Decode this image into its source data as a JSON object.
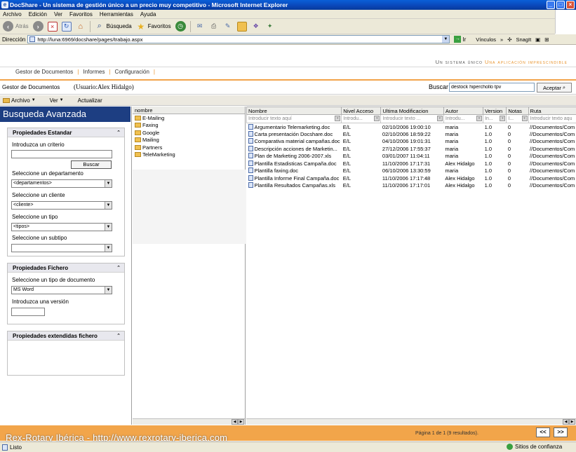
{
  "window": {
    "title": "DocShare - Un sistema de gestión único a un precio muy competitivo - Microsoft Internet Explorer"
  },
  "menu": [
    "Archivo",
    "Edición",
    "Ver",
    "Favoritos",
    "Herramientas",
    "Ayuda"
  ],
  "toolbar": {
    "back_label": "Atrás",
    "search_label": "Búsqueda",
    "favorites_label": "Favoritos"
  },
  "address": {
    "label": "Dirección",
    "url": "http://luna:6969/docshare/pages/trabajo.aspx",
    "go_label": "Ir",
    "links_label": "Vínculos",
    "snagit_label": "SnagIt"
  },
  "header": {
    "slogan_part1": "Un sistema único",
    "slogan_part2": "Una aplicación imprescindible",
    "nav": [
      "Gestor de Documentos",
      "Informes",
      "Configuración"
    ]
  },
  "context": {
    "title": "Gestor de Documentos",
    "user": "(Usuario:Alex Hidalgo)",
    "search_label": "Buscar",
    "search_value": "destock hiperchollo tpv",
    "accept_label": "Aceptar"
  },
  "actions": {
    "archivo": "Archivo",
    "ver": "Ver",
    "actualizar": "Actualizar"
  },
  "left": {
    "title": "Busqueda Avanzada",
    "standard": {
      "heading": "Propiedades Estandar",
      "criterio_label": "Introduzca un criterio",
      "buscar_label": "Buscar",
      "dept_label": "Seleccione un departamento",
      "dept_value": "<departamentos>",
      "client_label": "Seleccione un cliente",
      "client_value": "<cliente>",
      "type_label": "Seleccione un tipo",
      "type_value": "<tipos>",
      "subtype_label": "Seleccione un subtipo",
      "subtype_value": ""
    },
    "file": {
      "heading": "Propiedades Fichero",
      "doctype_label": "Seleccione un tipo de documento",
      "doctype_value": "MS Word",
      "version_label": "Introduzca una versión"
    },
    "extended": {
      "heading": "Propiedades extendidas fichero"
    }
  },
  "folders": {
    "column": "nombre",
    "items": [
      "E-Mailing",
      "Faxing",
      "Google",
      "Mailing",
      "Partners",
      "TeleMarketing"
    ]
  },
  "files": {
    "columns": [
      "Nombre",
      "Nivel Acceso",
      "Ultima Modificacion",
      "Autor",
      "Version",
      "Notas",
      "Ruta"
    ],
    "filters": [
      "Introducir texto aquí",
      "Introdu...",
      "Introducir texto ...",
      "Introdu...",
      "In...",
      "I...",
      "Introducir texto aqu"
    ],
    "rows": [
      [
        "Argumentario Telemarketing.doc",
        "E/L",
        "02/10/2006 19:00:10",
        "maria",
        "1.0",
        "0",
        "//Documentos/Com"
      ],
      [
        "Carta presentación Docshare.doc",
        "E/L",
        "02/10/2006 18:59:22",
        "maria",
        "1.0",
        "0",
        "//Documentos/Com"
      ],
      [
        "Comparativa material campañas.doc",
        "E/L",
        "04/10/2006 19:01:31",
        "maria",
        "1.0",
        "0",
        "//Documentos/Com"
      ],
      [
        "Descripción acciones de Marketin...",
        "E/L",
        "27/12/2006 17:55:37",
        "maria",
        "1.0",
        "0",
        "//Documentos/Com"
      ],
      [
        "Plan de Marketing 2006-2007.xls",
        "E/L",
        "03/01/2007 11:04:11",
        "maria",
        "1.0",
        "0",
        "//Documentos/Com"
      ],
      [
        "Plantilla Estadisticas Campaña.doc",
        "E/L",
        "11/10/2006 17:17:31",
        "Alex Hidalgo",
        "1.0",
        "0",
        "//Documentos/Com"
      ],
      [
        "Plantilla faxing.doc",
        "E/L",
        "06/10/2006 13:30:59",
        "maria",
        "1.0",
        "0",
        "//Documentos/Com"
      ],
      [
        "Plantilla Informe Final Campaña.doc",
        "E/L",
        "11/10/2006 17:17:48",
        "Alex Hidalgo",
        "1.0",
        "0",
        "//Documentos/Com"
      ],
      [
        "Plantilla Resultados Campañas.xls",
        "E/L",
        "11/10/2006 17:17:01",
        "Alex Hidalgo",
        "1.0",
        "0",
        "//Documentos/Com"
      ]
    ]
  },
  "paging": {
    "text": "Página 1 de 1 (9 resultados).",
    "prev": "<<",
    "next": ">>"
  },
  "watermark": "Rex-Rotary Ibérica - http://www.rexrotary-iberica.com",
  "status": {
    "left": "Listo",
    "right": "Sitios de confianza"
  }
}
